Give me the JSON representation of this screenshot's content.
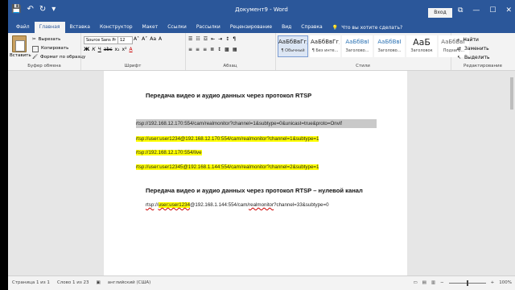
{
  "window": {
    "title": "Документ9 - Word",
    "signin": "Вход",
    "qat_save": "💾",
    "qat_undo": "↶",
    "qat_redo": "↻",
    "qat_more": "▾",
    "win_restore": "⧉",
    "win_min": "—",
    "win_max": "☐",
    "win_close": "✕"
  },
  "tabs": [
    "Файл",
    "Главная",
    "Вставка",
    "Конструктор",
    "Макет",
    "Ссылки",
    "Рассылки",
    "Рецензирование",
    "Вид",
    "Справка"
  ],
  "tell_me": "Что вы хотите сделать?",
  "ribbon": {
    "clipboard": {
      "paste": "Вставить",
      "cut": "Вырезать",
      "copy": "Копировать",
      "format_painter": "Формат по образцу",
      "label": "Буфер обмена"
    },
    "font": {
      "name": "Source Sans Pr",
      "size": "12",
      "label": "Шрифт",
      "bold": "Ж",
      "italic": "К",
      "underline": "Ч",
      "strike": "abc",
      "sub": "x₂",
      "sup": "x²",
      "grow": "A˄",
      "shrink": "A˅",
      "case": "Aa",
      "clear": "A",
      "color": "A"
    },
    "paragraph": {
      "label": "Абзац",
      "bullets": "☰",
      "numbers": "☷",
      "multilevel": "☲",
      "decrease": "⇤",
      "increase": "⇥",
      "sort": "↕",
      "marks": "¶",
      "align_left": "≡",
      "align_center": "≡",
      "align_right": "≡",
      "justify": "≣",
      "spacing": "↕",
      "shading": "▩",
      "borders": "▦"
    },
    "styles": {
      "label": "Стили",
      "items": [
        {
          "sample": "АаБбВвГг,",
          "name": "¶ Обычный"
        },
        {
          "sample": "АаБбВвГг,",
          "name": "¶ Без инте..."
        },
        {
          "sample": "АаБбВвІ",
          "name": "Заголово..."
        },
        {
          "sample": "АаБбВвІ",
          "name": "Заголово..."
        },
        {
          "sample": "АаБ",
          "name": "Заголовок"
        },
        {
          "sample": "АаБбВвГ",
          "name": "Подзаго..."
        }
      ]
    },
    "editing": {
      "find": "Найти",
      "replace": "Заменить",
      "select": "Выделить",
      "label": "Редактирование"
    }
  },
  "document": {
    "heading1": "Передача видео и аудио данных через протокол RTSP",
    "line1": "rtsp://192.168.12.170:554/cam/realmonitor?channel=1&subtype=0&unicast=true&proto=Onvif",
    "line2": "rtsp://user:user1234@192.168.12.170:554/cam/realmonitor?channel=1&subtype=1",
    "line3": "rtsp://192.168.12.170:554/live",
    "line4": "rtsp://user:user12345@192.168.1.144:554/cam/realmonitor?channel=2&subtype=1",
    "heading2": "Передача видео и аудио данных через протокол RTSP – нулевой канал",
    "line5_a": "rtsp",
    "line5_b": "://",
    "line5_c": "user:user1234",
    "line5_d": "@192.168.1.144:554/cam/",
    "line5_e": "realmonitor",
    "line5_f": "?channel=33&subtype=0"
  },
  "status": {
    "page": "Страница 1 из 1",
    "words": "Слово 1 из 23",
    "lang": "английский (США)",
    "zoom": "100%",
    "zoom_minus": "−",
    "zoom_plus": "+"
  }
}
